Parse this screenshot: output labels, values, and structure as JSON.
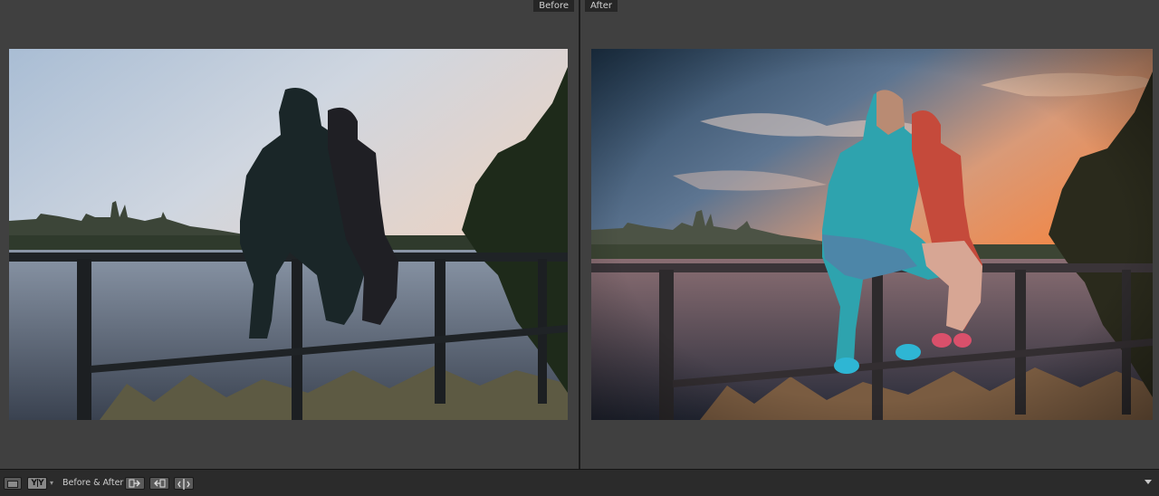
{
  "compare": {
    "before_label": "Before",
    "after_label": "After"
  },
  "toolbar": {
    "view_mode_glyph": "Y|Y",
    "before_after_label": "Before & After :",
    "icons": [
      "loupe-view-icon",
      "compare-view-icon",
      "copy-settings-left-to-right-icon",
      "copy-settings-right-to-left-icon",
      "swap-before-after-icon",
      "toolbar-menu-icon"
    ]
  },
  "colors": {
    "background": "#404040",
    "toolbar": "#2b2b2b",
    "label_bg": "#262626",
    "after_sky_orange": "#e88a52",
    "after_sky_blue": "#2f4e6b"
  }
}
